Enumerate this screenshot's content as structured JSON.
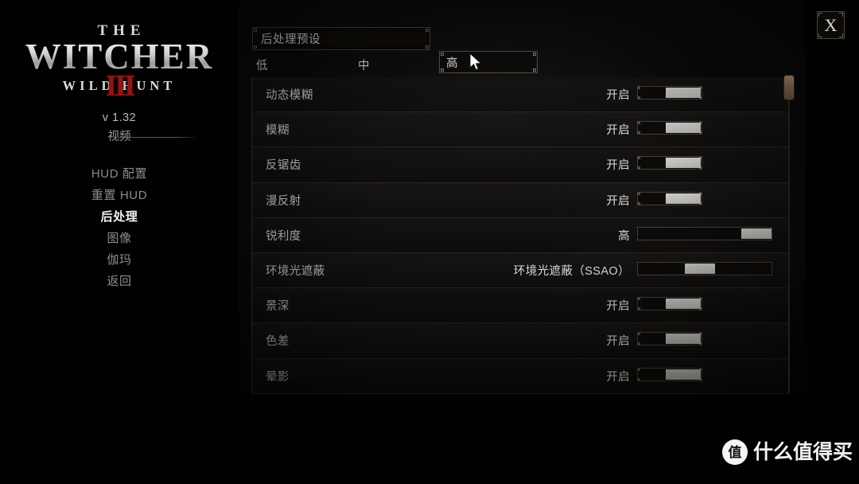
{
  "game": {
    "logo_the": "THE",
    "logo_main": "WITCHER",
    "logo_numeral": "III",
    "logo_sub": "WILD  HUNT",
    "version": "v 1.32",
    "section": "视频"
  },
  "sidebar": {
    "items": [
      {
        "label": "HUD 配置",
        "active": false
      },
      {
        "label": "重置 HUD",
        "active": false
      },
      {
        "label": "后处理",
        "active": true
      },
      {
        "label": "图像",
        "active": false
      },
      {
        "label": "伽玛",
        "active": false
      },
      {
        "label": "返回",
        "active": false
      }
    ]
  },
  "window": {
    "close_label": "X"
  },
  "preset": {
    "title": "后处理预设",
    "options": [
      {
        "label": "低",
        "selected": false
      },
      {
        "label": "中",
        "selected": false
      },
      {
        "label": "高",
        "selected": true
      }
    ],
    "selected": "高"
  },
  "settings": {
    "rows": [
      {
        "label": "动态模糊",
        "value": "开启",
        "control": "toggle",
        "fill": 55
      },
      {
        "label": "模糊",
        "value": "开启",
        "control": "toggle",
        "fill": 55
      },
      {
        "label": "反锯齿",
        "value": "开启",
        "control": "toggle",
        "fill": 55
      },
      {
        "label": "漫反射",
        "value": "开启",
        "control": "toggle",
        "fill": 55
      },
      {
        "label": "锐利度",
        "value": "高",
        "control": "slider",
        "fill": 100
      },
      {
        "label": "环境光遮蔽",
        "value": "环境光遮蔽（SSAO）",
        "control": "slider",
        "fill": 45
      },
      {
        "label": "景深",
        "value": "开启",
        "control": "toggle",
        "fill": 55
      },
      {
        "label": "色差",
        "value": "开启",
        "control": "toggle",
        "fill": 55
      },
      {
        "label": "晕影",
        "value": "开启",
        "control": "toggle",
        "fill": 55
      }
    ]
  },
  "scrollbar": {
    "thumb_position_pct": 0
  },
  "watermark": {
    "badge": "值",
    "text": "什么值得买"
  },
  "colors": {
    "background": "#010101",
    "panel": "#0a0909",
    "frame_gold": "#6b5946",
    "text_primary": "#cfcfcd",
    "text_dim": "#8d8d8b",
    "slider_fill": "#c6c6c2",
    "scroll_thumb": "#6b5744",
    "logo_red": "#8e1717"
  }
}
